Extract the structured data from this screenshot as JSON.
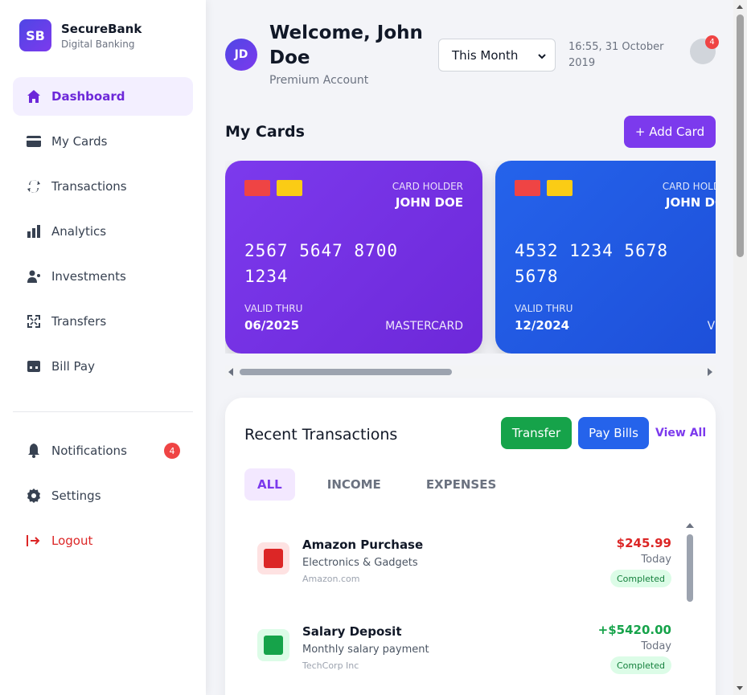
{
  "brand": {
    "logo_text": "SB",
    "name": "SecureBank",
    "subtitle": "Digital Banking"
  },
  "nav": {
    "items": [
      {
        "label": "Dashboard",
        "icon": "home-icon",
        "active": true
      },
      {
        "label": "My Cards",
        "icon": "credit-card-icon"
      },
      {
        "label": "Transactions",
        "icon": "exchange-icon"
      },
      {
        "label": "Analytics",
        "icon": "bar-chart-icon"
      },
      {
        "label": "Investments",
        "icon": "user-investments-icon"
      },
      {
        "label": "Transfers",
        "icon": "expand-arrows-icon"
      },
      {
        "label": "Bill Pay",
        "icon": "bill-icon"
      }
    ],
    "secondary": [
      {
        "label": "Notifications",
        "icon": "bell-icon",
        "badge": "4"
      },
      {
        "label": "Settings",
        "icon": "gear-icon"
      },
      {
        "label": "Logout",
        "icon": "logout-icon"
      }
    ]
  },
  "header": {
    "avatar_initials": "JD",
    "welcome": "Welcome, John Doe",
    "account_type": "Premium Account",
    "period_select": {
      "selected": "This Month"
    },
    "datetime": "16:55, 31 October 2019",
    "notification_count": "4"
  },
  "cards": {
    "title": "My Cards",
    "add_label": "+ Add Card",
    "items": [
      {
        "holder_label": "CARD HOLDER",
        "holder": "JOHN DOE",
        "number": "2567 5647 8700 1234",
        "valid_label": "VALID THRU",
        "valid": "06/2025",
        "network": "MASTERCARD",
        "color": "#7c3aed"
      },
      {
        "holder_label": "CARD HOLDER",
        "holder": "JOHN DOE",
        "number": "4532 1234 5678 5678",
        "valid_label": "VALID THRU",
        "valid": "12/2024",
        "network": "VISA",
        "color": "#2563eb"
      }
    ]
  },
  "transactions": {
    "title": "Recent Transactions",
    "transfer_label": "Transfer",
    "paybills_label": "Pay Bills",
    "view_all_label": "View All",
    "tabs": [
      "ALL",
      "INCOME",
      "EXPENSES"
    ],
    "items": [
      {
        "name": "Amazon Purchase",
        "description": "Electronics & Gadgets",
        "merchant": "Amazon.com",
        "amount": "$245.99",
        "when": "Today",
        "status": "Completed",
        "amount_color": "#dc2626",
        "icon_bg": "#fee2e2",
        "icon_fg": "#dc2626"
      },
      {
        "name": "Salary Deposit",
        "description": "Monthly salary payment",
        "merchant": "TechCorp Inc",
        "amount": "+$5420.00",
        "when": "Today",
        "status": "Completed",
        "amount_color": "#16a34a",
        "icon_bg": "#dcfce7",
        "icon_fg": "#16a34a"
      }
    ]
  },
  "colors": {
    "accent": "#7c3aed",
    "success": "#16a34a",
    "primary": "#2563eb",
    "danger": "#ef4444"
  }
}
